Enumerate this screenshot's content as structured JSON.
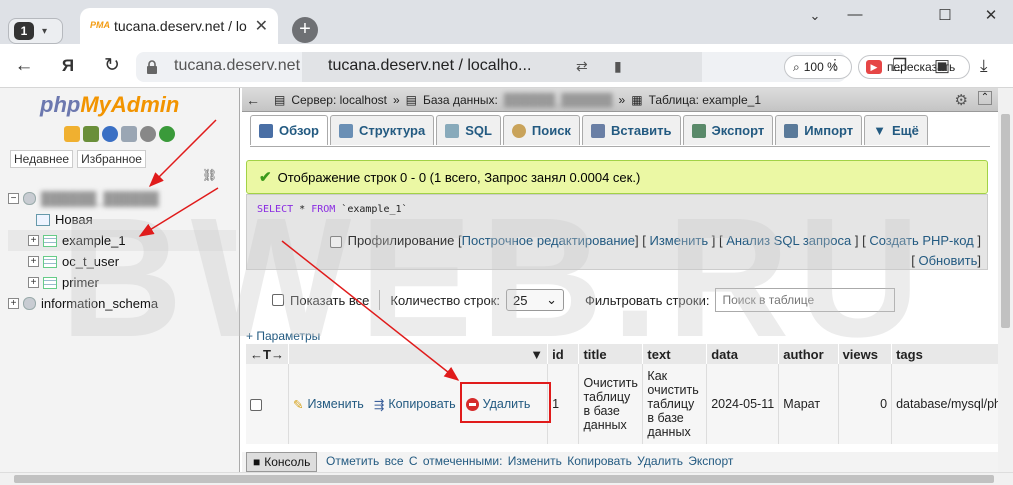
{
  "browser": {
    "tab_count": "1",
    "tab_title": "tucana.deserv.net / loca",
    "url_host": "tucana.deserv.net",
    "url_path": "tucana.deserv.net / localho...",
    "zoom": "100 %",
    "retell_label": "пересказать",
    "accent": "#e64646"
  },
  "pma": {
    "logo_php": "php",
    "logo_myadmin": "MyAdmin",
    "tabs": [
      "Недавнее",
      "Избранное"
    ],
    "tree": {
      "table_new": "Новая",
      "tables": [
        "example_1",
        "oc_t_user",
        "primer"
      ],
      "info_db": "information_schema"
    },
    "breadcrumb": {
      "server": "Сервер: localhost",
      "database": "База данных:",
      "table": "Таблица: example_1"
    },
    "menu": [
      "Обзор",
      "Структура",
      "SQL",
      "Поиск",
      "Вставить",
      "Экспорт",
      "Импорт",
      "Ещё"
    ],
    "success_message": "Отображение строк 0 - 0 (1 всего, Запрос занял 0.0004 сек.)",
    "sql": {
      "select": "SELECT",
      "star": " * ",
      "from": "FROM",
      "table": " `example_1`"
    },
    "sql_links": {
      "profiling": "Профилирование",
      "inline_edit": "Построчное редактирование",
      "edit": "Изменить",
      "analyze": "Анализ SQL запроса",
      "create_php": "Создать PHP-код",
      "refresh": "Обновить"
    },
    "controls": {
      "show_all": "Показать все",
      "row_count_label": "Количество строк:",
      "row_count_value": "25",
      "filter_label": "Фильтровать строки:",
      "filter_placeholder": "Поиск в таблице"
    },
    "params": "+ Параметры",
    "columns": [
      "id",
      "title",
      "text",
      "data",
      "author",
      "views",
      "tags"
    ],
    "row_actions": {
      "edit": "Изменить",
      "copy": "Копировать",
      "delete": "Удалить"
    },
    "row": {
      "id": "1",
      "title": "Очистить таблицу в базе данных",
      "text": "Как очистить таблицу в базе данных",
      "data": "2024-05-11",
      "author": "Марат",
      "views": "0",
      "tags": "database/mysql/ph"
    },
    "console": "Консоль",
    "footer_actions": "Отметить все    С отмеченными:    Изменить    Копировать    Удалить    Экспорт"
  },
  "watermark": "BWEB.RU"
}
